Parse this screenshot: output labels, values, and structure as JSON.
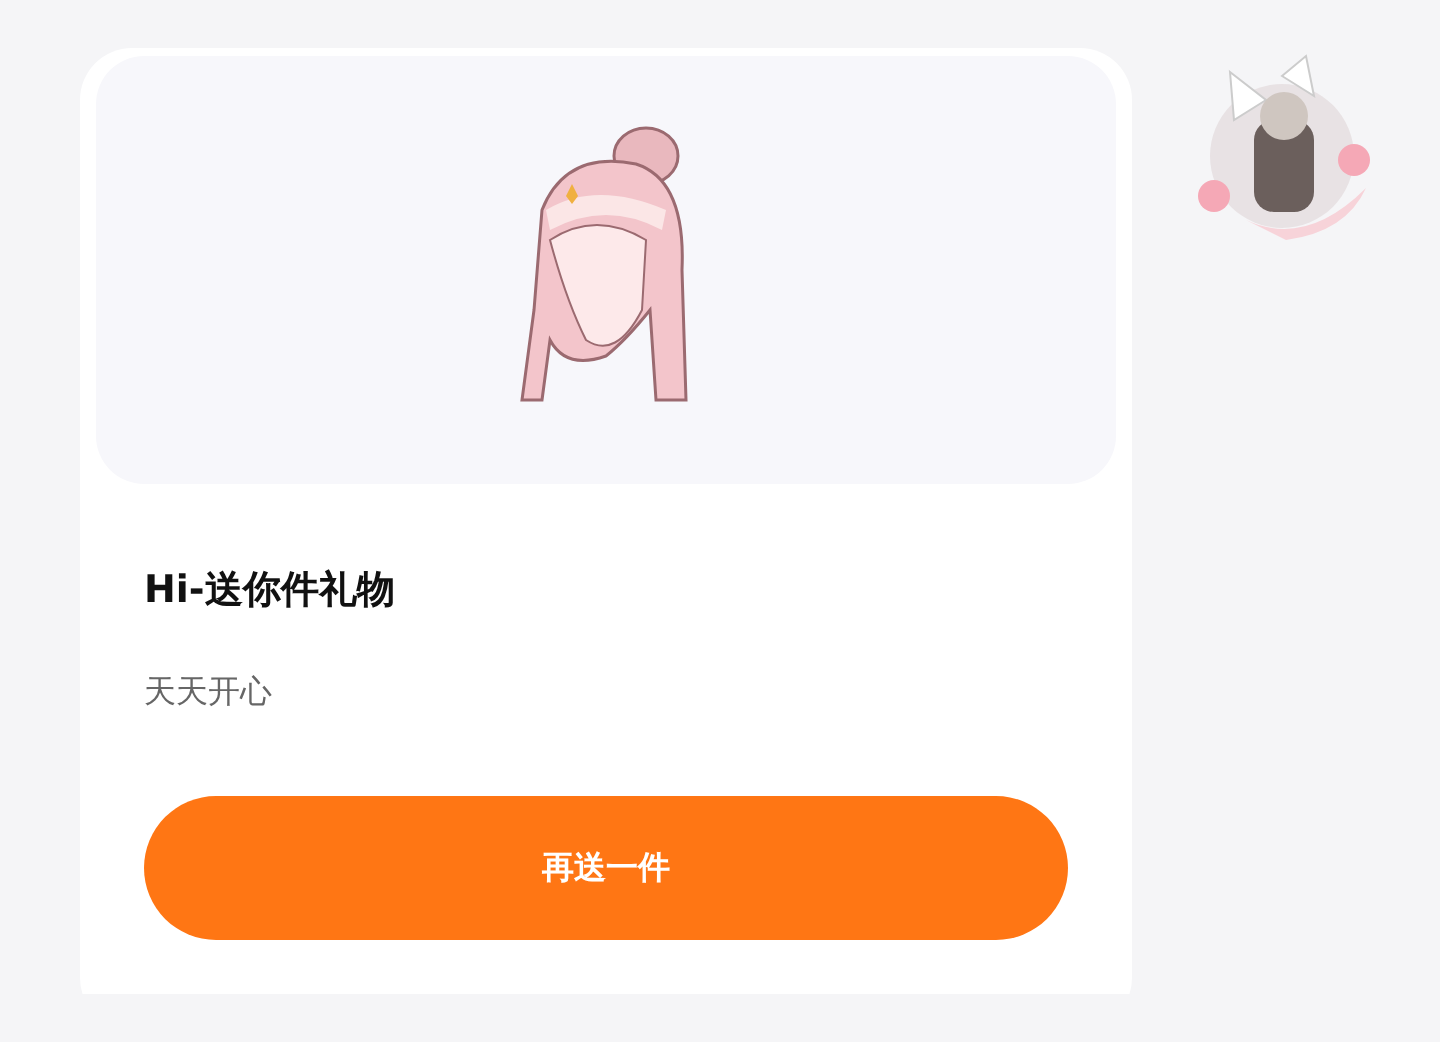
{
  "gift_card": {
    "title": "Hi-送你件礼物",
    "message": "天天开心",
    "button": "再送一件"
  }
}
